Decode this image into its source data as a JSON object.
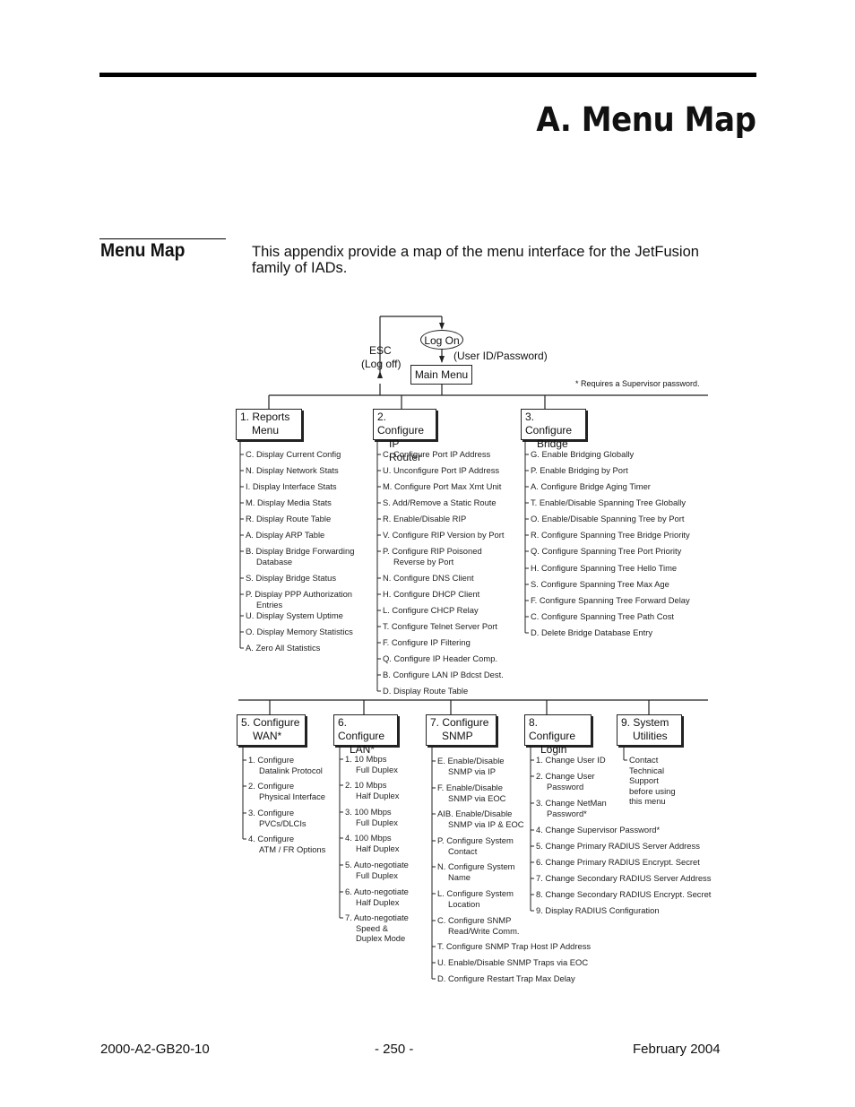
{
  "chapter_title": "A.  Menu Map",
  "section": {
    "title": "Menu Map",
    "intro": "This appendix provide a map of the menu interface for the JetFusion family of IADs."
  },
  "diagram": {
    "logon": "Log On",
    "esc": "ESC",
    "log_off": "(Log off)",
    "user_pw": "(User ID/Password)",
    "main_menu": "Main Menu",
    "supervisor_note": "* Requires a Supervisor password.",
    "menus": [
      {
        "title1": "1. Reports",
        "title2": "Menu",
        "items": [
          [
            "C. Display Current Config"
          ],
          [
            "N. Display Network Stats"
          ],
          [
            "I.  Display Interface Stats"
          ],
          [
            "M. Display Media Stats"
          ],
          [
            "R. Display Route Table"
          ],
          [
            "A. Display ARP Table"
          ],
          [
            "B. Display Bridge Forwarding",
            "Database"
          ],
          [
            "S. Display Bridge Status"
          ],
          [
            "P. Display PPP Authorization",
            "Entries"
          ],
          [
            "U.  Display System Uptime"
          ],
          [
            "O. Display Memory Statistics"
          ],
          [
            "A. Zero All Statistics"
          ]
        ]
      },
      {
        "title1": "2. Configure",
        "title2": "IP Router",
        "items": [
          [
            "C. Configure Port IP Address"
          ],
          [
            "U. Unconfigure Port IP Address"
          ],
          [
            "M. Configure Port Max Xmt Unit"
          ],
          [
            "S.  Add/Remove a Static Route"
          ],
          [
            "R. Enable/Disable RIP"
          ],
          [
            "V.  Configure RIP Version by Port"
          ],
          [
            "P.  Configure RIP Poisoned",
            "Reverse by Port"
          ],
          [
            "N. Configure DNS Client"
          ],
          [
            "H. Configure DHCP Client"
          ],
          [
            "L. Configure CHCP Relay"
          ],
          [
            "T.  Configure Telnet Server Port"
          ],
          [
            "F. Configure IP Filtering"
          ],
          [
            "Q. Configure IP Header Comp."
          ],
          [
            "B. Configure LAN IP Bdcst Dest."
          ],
          [
            "D. Display Route Table"
          ]
        ]
      },
      {
        "title1": "3. Configure",
        "title2": "Bridge",
        "items": [
          [
            "G. Enable Bridging Globally"
          ],
          [
            "P.  Enable Bridging by Port"
          ],
          [
            "A.  Configure Bridge Aging Timer"
          ],
          [
            "T.  Enable/Disable Spanning Tree Globally"
          ],
          [
            "O. Enable/Disable Spanning Tree by Port"
          ],
          [
            "R. Configure Spanning Tree Bridge Priority"
          ],
          [
            "Q. Configure Spanning Tree Port Priority"
          ],
          [
            "H. Configure Spanning Tree Hello Time"
          ],
          [
            "S.  Configure Spanning Tree Max Age"
          ],
          [
            "F.  Configure Spanning Tree Forward Delay"
          ],
          [
            "C.  Configure Spanning Tree Path Cost"
          ],
          [
            "D. Delete Bridge Database Entry"
          ]
        ]
      },
      {
        "title1": "5. Configure",
        "title2": "WAN*",
        "items": [
          [
            "1.  Configure",
            "Datalink Protocol"
          ],
          [
            "2. Configure",
            "Physical Interface"
          ],
          [
            "3. Configure",
            "PVCs/DLCIs"
          ],
          [
            "4. Configure",
            "ATM / FR Options"
          ]
        ]
      },
      {
        "title1": "6. Configure",
        "title2": "LAN*",
        "items": [
          [
            "1. 10 Mbps",
            "Full Duplex"
          ],
          [
            "2.  10 Mbps",
            "Half Duplex"
          ],
          [
            "3. 100 Mbps",
            "Full Duplex"
          ],
          [
            "4. 100 Mbps",
            "Half Duplex"
          ],
          [
            "5.  Auto-negotiate",
            "Full Duplex"
          ],
          [
            "6.  Auto-negotiate",
            "Half Duplex"
          ],
          [
            "7.  Auto-negotiate",
            "Speed &",
            "Duplex Mode"
          ]
        ]
      },
      {
        "title1": "7. Configure",
        "title2": "SNMP",
        "items": [
          [
            "E.  Enable/Disable",
            "SNMP via IP"
          ],
          [
            "F.  Enable/Disable",
            "SNMP via EOC"
          ],
          [
            "AIB. Enable/Disable",
            "SNMP via IP & EOC"
          ],
          [
            "P.  Configure System",
            "Contact"
          ],
          [
            "N.  Configure System",
            "Name"
          ],
          [
            "L.  Configure System",
            "Location"
          ],
          [
            "C. Configure SNMP",
            "Read/Write Comm."
          ],
          [
            "T.  Configure SNMP Trap Host IP Address"
          ],
          [
            "U.  Enable/Disable SNMP Traps via EOC"
          ],
          [
            "D.  Configure Restart Trap Max Delay"
          ]
        ]
      },
      {
        "title1": "8. Configure",
        "title2": "Login",
        "items": [
          [
            "1.  Change User ID"
          ],
          [
            "2.  Change User",
            "Password"
          ],
          [
            "3.  Change NetMan",
            "Password*"
          ],
          [
            "4.  Change Supervisor Password*"
          ],
          [
            "5.  Change Primary RADIUS Server Address"
          ],
          [
            "6. Change Primary RADIUS Encrypt. Secret"
          ],
          [
            "7.  Change Secondary RADIUS Server Address"
          ],
          [
            "8.  Change Secondary RADIUS Encrypt. Secret"
          ],
          [
            "9.  Display RADIUS Configuration"
          ]
        ]
      },
      {
        "title1": "9. System",
        "title2": "Utilities",
        "items": [
          [
            "Contact",
            "Technical",
            "Support",
            "before using",
            "this menu"
          ]
        ]
      }
    ]
  },
  "footer": {
    "doc_number": "2000-A2-GB20-10",
    "page": "- 250 -",
    "date": "February 2004"
  }
}
